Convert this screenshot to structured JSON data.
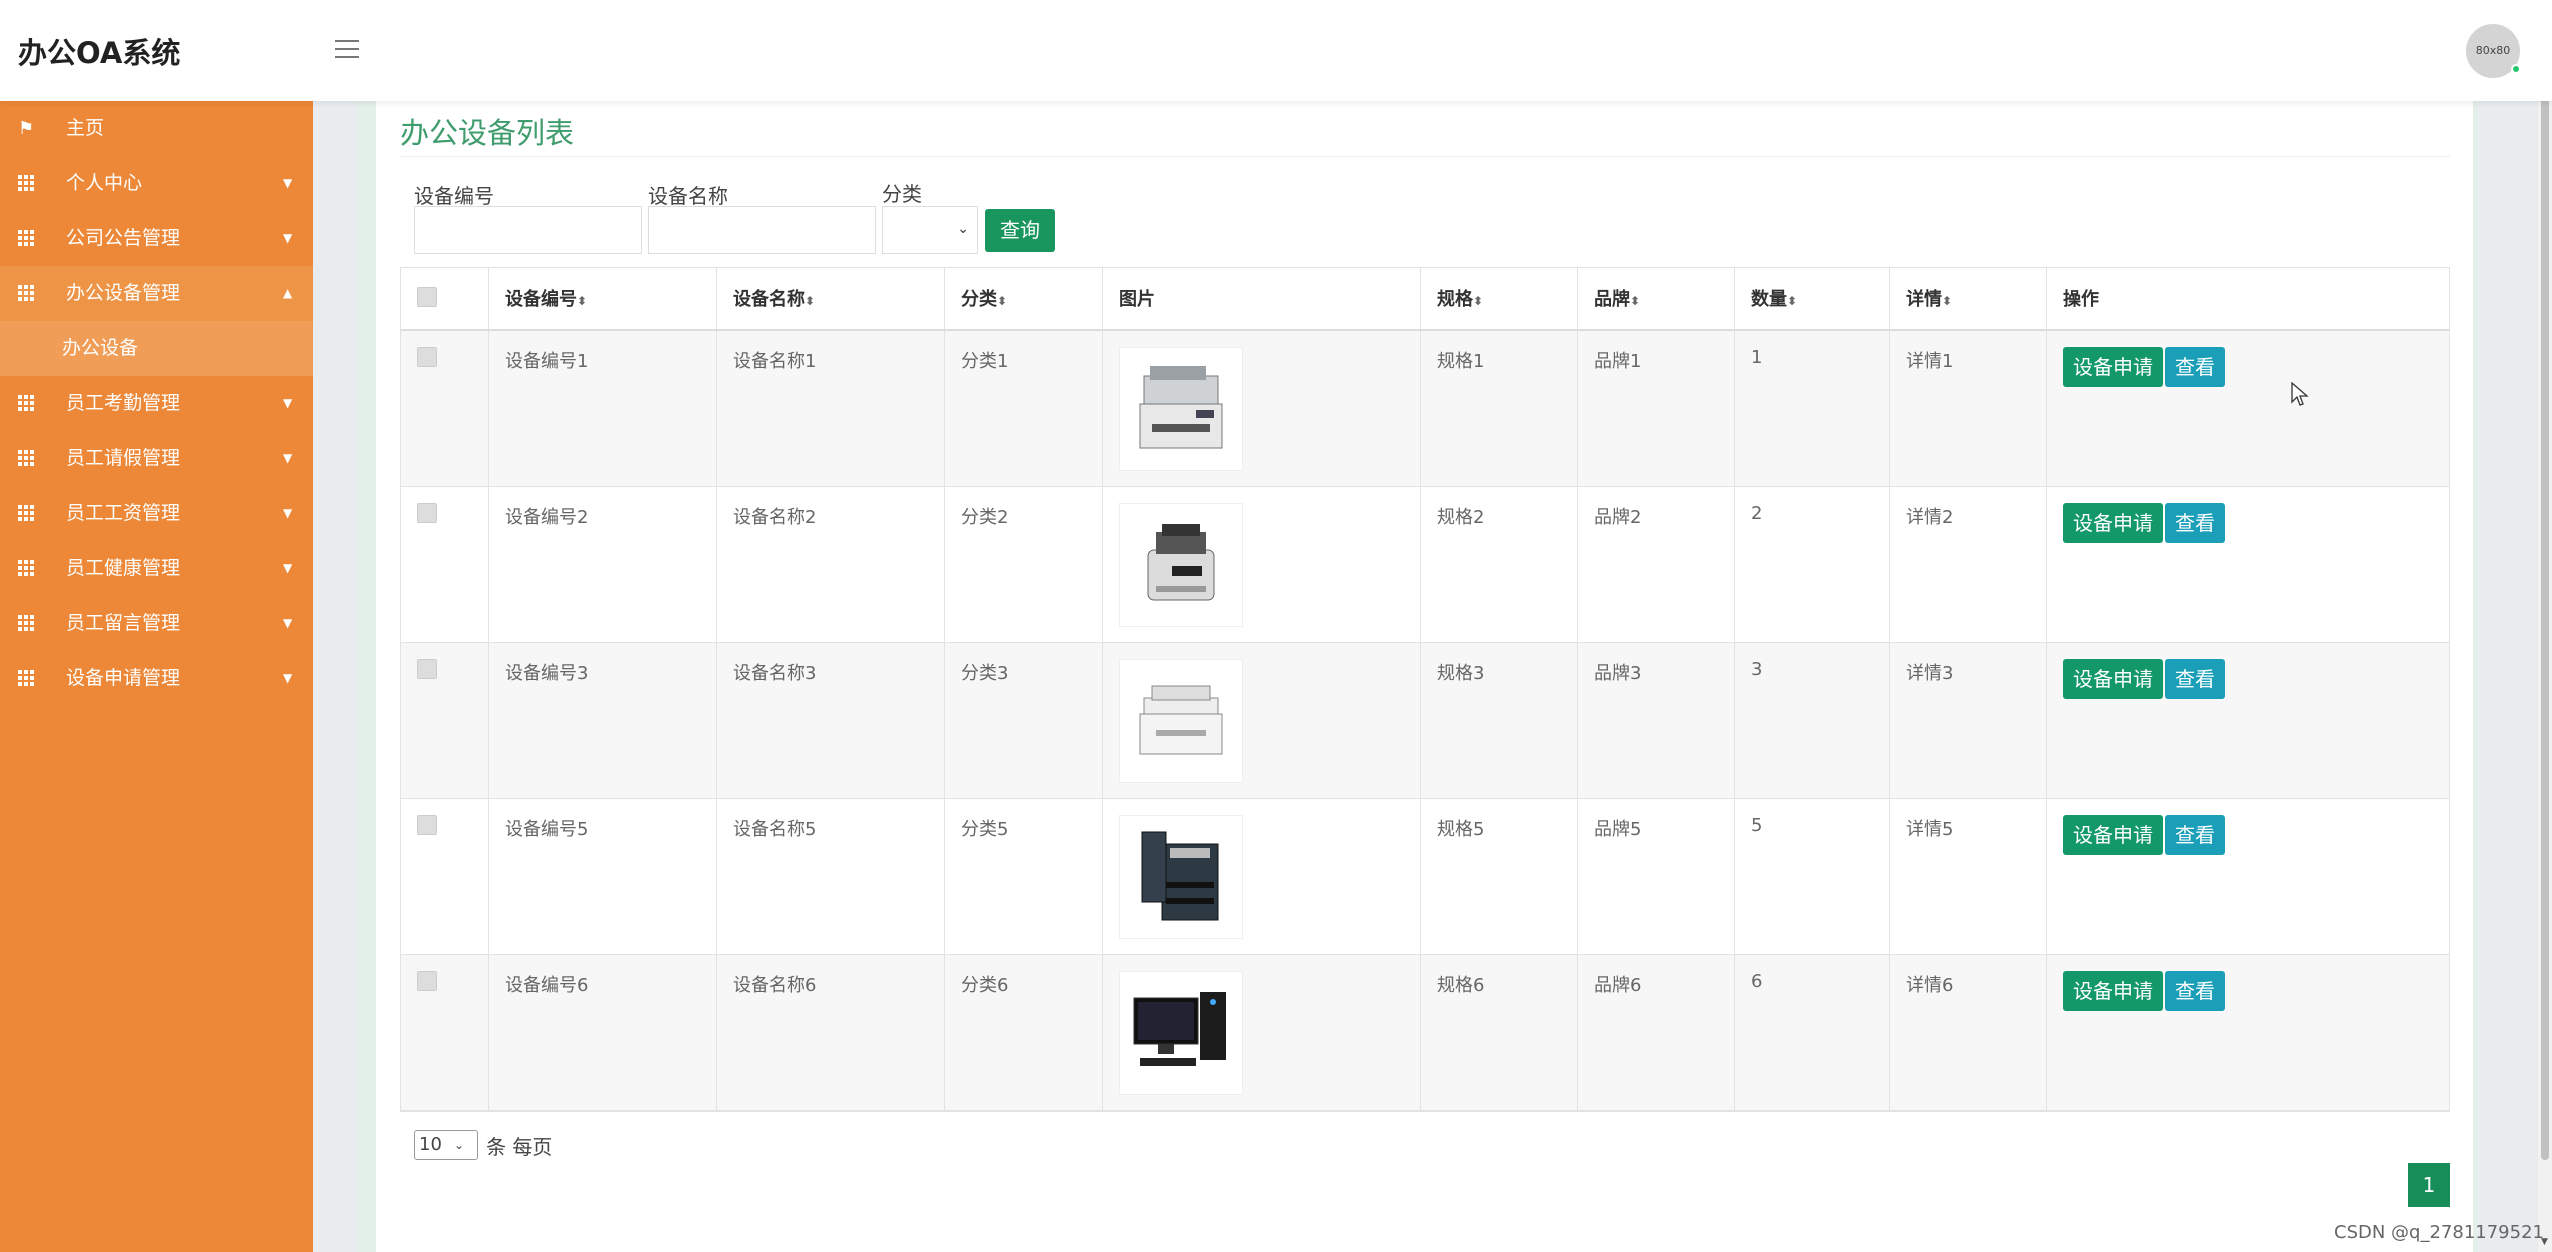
{
  "app": {
    "title": "办公OA系统",
    "avatar_text": "80x80"
  },
  "sidebar": {
    "items": [
      {
        "label": "主页",
        "icon": "flag-icon"
      },
      {
        "label": "个人中心",
        "icon": "grid-icon"
      },
      {
        "label": "公司公告管理",
        "icon": "grid-icon"
      },
      {
        "label": "办公设备管理",
        "icon": "grid-icon",
        "expanded": true,
        "sub": "办公设备"
      },
      {
        "label": "员工考勤管理",
        "icon": "grid-icon"
      },
      {
        "label": "员工请假管理",
        "icon": "grid-icon"
      },
      {
        "label": "员工工资管理",
        "icon": "grid-icon"
      },
      {
        "label": "员工健康管理",
        "icon": "grid-icon"
      },
      {
        "label": "员工留言管理",
        "icon": "grid-icon"
      },
      {
        "label": "设备申请管理",
        "icon": "grid-icon"
      }
    ]
  },
  "main": {
    "title": "办公设备列表",
    "filters": {
      "code_label": "设备编号",
      "name_label": "设备名称",
      "category_label": "分类",
      "query_button": "查询"
    },
    "table": {
      "headers": [
        "设备编号",
        "设备名称",
        "分类",
        "图片",
        "规格",
        "品牌",
        "数量",
        "详情",
        "操作"
      ],
      "rows": [
        {
          "code": "设备编号1",
          "name": "设备名称1",
          "category": "分类1",
          "image": "copier",
          "spec": "规格1",
          "brand": "品牌1",
          "qty": "1",
          "detail": "详情1"
        },
        {
          "code": "设备编号2",
          "name": "设备名称2",
          "category": "分类2",
          "image": "money-counter",
          "spec": "规格2",
          "brand": "品牌2",
          "qty": "2",
          "detail": "详情2"
        },
        {
          "code": "设备编号3",
          "name": "设备名称3",
          "category": "分类3",
          "image": "scanner-printer",
          "spec": "规格3",
          "brand": "品牌3",
          "qty": "3",
          "detail": "详情3"
        },
        {
          "code": "设备编号5",
          "name": "设备名称5",
          "category": "分类5",
          "image": "office-copier",
          "spec": "规格5",
          "brand": "品牌5",
          "qty": "5",
          "detail": "详情5"
        },
        {
          "code": "设备编号6",
          "name": "设备名称6",
          "category": "分类6",
          "image": "desktop-computer",
          "spec": "规格6",
          "brand": "品牌6",
          "qty": "6",
          "detail": "详情6"
        }
      ],
      "apply_label": "设备申请",
      "view_label": "查看"
    },
    "pagination": {
      "page_size": "10",
      "per_page_label": "条 每页",
      "current_page": "1"
    }
  },
  "watermark": "CSDN @q_2781179521",
  "colors": {
    "sidebar": "#ec8838",
    "accent": "#18965d",
    "view": "#1b9fb8"
  }
}
